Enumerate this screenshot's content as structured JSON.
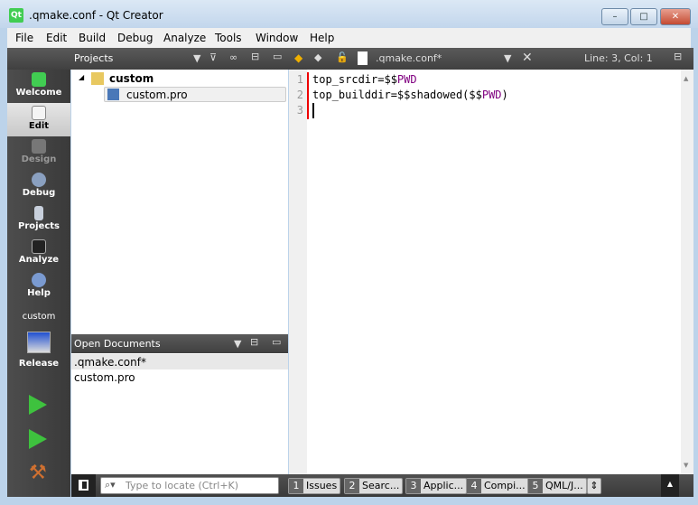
{
  "window": {
    "title": ".qmake.conf - Qt Creator",
    "app_icon": "Qt",
    "minimize": "–",
    "maximize": "□",
    "close": "✕"
  },
  "menu": [
    "File",
    "Edit",
    "Build",
    "Debug",
    "Analyze",
    "Tools",
    "Window",
    "Help"
  ],
  "projects_panel": {
    "title": "Projects",
    "tree": [
      {
        "label": "custom",
        "level": 0
      },
      {
        "label": "custom.pro",
        "level": 1
      }
    ]
  },
  "modes": [
    {
      "label": "Welcome"
    },
    {
      "label": "Edit"
    },
    {
      "label": "Design"
    },
    {
      "label": "Debug"
    },
    {
      "label": "Projects"
    },
    {
      "label": "Analyze"
    },
    {
      "label": "Help"
    }
  ],
  "kit": {
    "project": "custom",
    "build": "Release"
  },
  "editor": {
    "file": ".qmake.conf*",
    "position": "Line: 3, Col: 1",
    "line_numbers": [
      "1",
      "2",
      "3"
    ],
    "lines": [
      [
        "top_srcdir=$$",
        "PWD",
        ""
      ],
      [
        "top_builddir=$$shadowed($$",
        "PWD",
        ")"
      ]
    ]
  },
  "open_documents": {
    "title": "Open Documents",
    "items": [
      ".qmake.conf*",
      "custom.pro"
    ]
  },
  "bottom": {
    "locator_placeholder": "Type to locate (Ctrl+K)",
    "tabs": [
      {
        "n": "1",
        "label": "Issues"
      },
      {
        "n": "2",
        "label": "Searc..."
      },
      {
        "n": "3",
        "label": "Applic..."
      },
      {
        "n": "4",
        "label": "Compi..."
      },
      {
        "n": "5",
        "label": "QML/J..."
      }
    ]
  },
  "colors": {
    "accent": "#41cd52",
    "keyword": "#800080",
    "marker": "#e00000"
  }
}
